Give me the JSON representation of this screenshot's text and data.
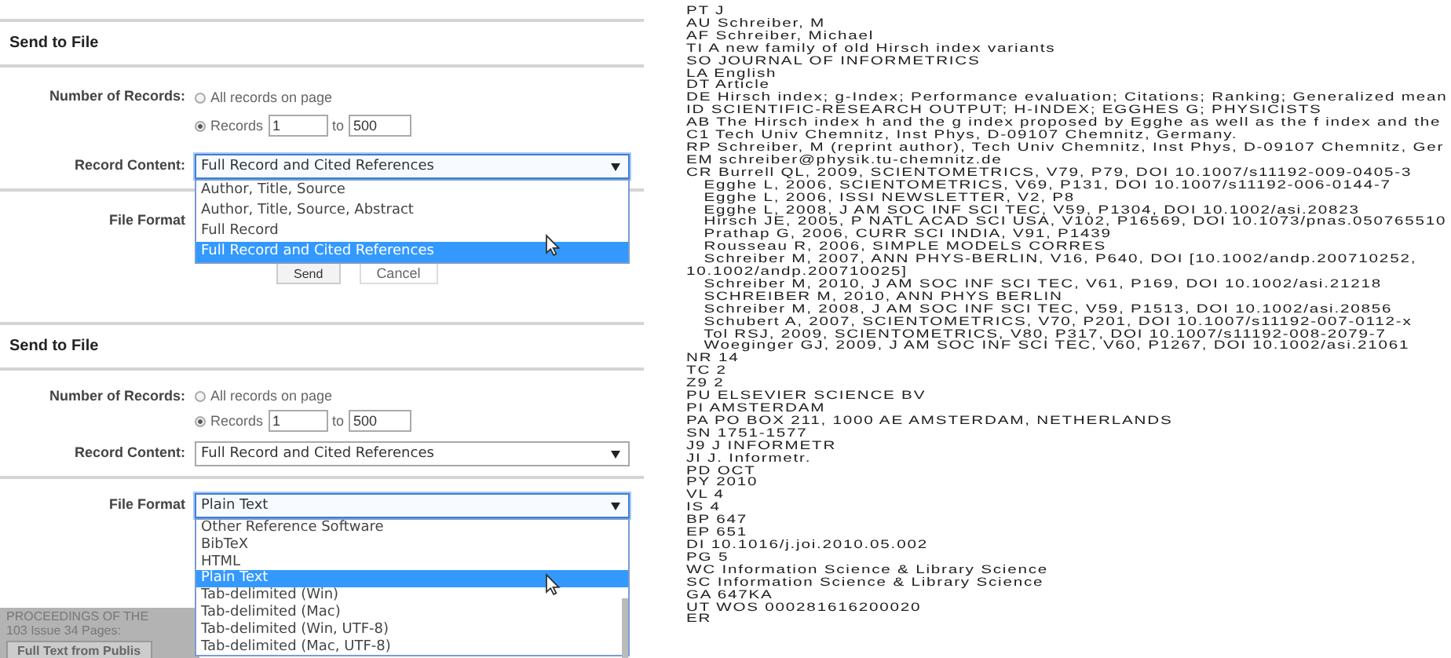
{
  "panels": [
    {
      "title": "Send to File",
      "sections": [
        {
          "fields": [
            {
              "kind": "radio_group",
              "label": "Number of Records:",
              "options": [
                {
                  "label": "All records on page",
                  "selected": false
                },
                {
                  "label": "Records",
                  "selected": true,
                  "from": "1",
                  "to_label": "to",
                  "to": "500"
                }
              ]
            },
            {
              "kind": "select",
              "label": "Record Content:",
              "value": "Full Record and Cited References",
              "expanded": true,
              "options": [
                {
                  "label": "Author, Title, Source",
                  "selected": false
                },
                {
                  "label": "Author, Title, Source, Abstract",
                  "selected": false
                },
                {
                  "label": "Full Record",
                  "selected": false
                },
                {
                  "label": "Full Record and Cited References",
                  "selected": true
                }
              ]
            }
          ]
        },
        {
          "fields": [
            {
              "kind": "select",
              "label": "File Format"
            }
          ],
          "buttons": [
            "Send",
            "Cancel"
          ]
        }
      ]
    },
    {
      "title": "Send to File",
      "sections": [
        {
          "fields": [
            {
              "kind": "radio_group",
              "label": "Number of Records:",
              "options": [
                {
                  "label": "All records on page",
                  "selected": false
                },
                {
                  "label": "Records",
                  "selected": true,
                  "from": "1",
                  "to_label": "to",
                  "to": "500"
                }
              ]
            },
            {
              "kind": "select",
              "label": "Record Content:",
              "value": "Full Record and Cited References",
              "expanded": false
            }
          ]
        },
        {
          "fields": [
            {
              "kind": "select",
              "label": "File Format",
              "value": "Plain Text",
              "expanded": true,
              "options": [
                {
                  "label": "Other Reference Software",
                  "selected": false
                },
                {
                  "label": "BibTeX",
                  "selected": false
                },
                {
                  "label": "HTML",
                  "selected": false
                },
                {
                  "label": "Plain Text",
                  "selected": true
                },
                {
                  "label": "Tab-delimited (Win)",
                  "selected": false
                },
                {
                  "label": "Tab-delimited (Mac)",
                  "selected": false
                },
                {
                  "label": "Tab-delimited (Win, UTF-8)",
                  "selected": false
                },
                {
                  "label": "Tab-delimited (Mac, UTF-8)",
                  "selected": false
                }
              ]
            }
          ]
        }
      ]
    }
  ],
  "background": {
    "lines": [
      "PROCEEDINGS OF THE",
      "103  Issue 34  Pages:"
    ],
    "button": "Full Text from Publis"
  },
  "record_lines": [
    "PT J",
    "AU Schreiber, M",
    "AF Schreiber, Michael",
    "TI A new family of old Hirsch index variants",
    "SO JOURNAL OF INFORMETRICS",
    "LA English",
    "DT Article",
    "DE Hirsch index; g-Index; Performance evaluation; Citations; Ranking; Generalized mean",
    "ID SCIENTIFIC-RESEARCH OUTPUT; H-INDEX; EGGHES G; PHYSICISTS",
    "AB The Hirsch index h and the g index proposed by Egghe as well as the f index and the",
    "C1 Tech Univ Chemnitz, Inst Phys, D-09107 Chemnitz, Germany.",
    "RP Schreiber, M (reprint author), Tech Univ Chemnitz, Inst Phys, D-09107 Chemnitz, Ger",
    "EM schreiber@physik.tu-chemnitz.de",
    "CR Burrell QL, 2009, SCIENTOMETRICS, V79, P79, DOI 10.1007/s11192-009-0405-3",
    "   Egghe L, 2006, SCIENTOMETRICS, V69, P131, DOI 10.1007/s11192-006-0144-7",
    "   Egghe L, 2006, ISSI NEWSLETTER, V2, P8",
    "   Egghe L, 2008, J AM SOC INF SCI TEC, V59, P1304, DOI 10.1002/asi.20823",
    "   Hirsch JE, 2005, P NATL ACAD SCI USA, V102, P16569, DOI 10.1073/pnas.050765510",
    "   Prathap G, 2006, CURR SCI INDIA, V91, P1439",
    "   Rousseau R, 2006, SIMPLE MODELS CORRES",
    "   Schreiber M, 2007, ANN PHYS-BERLIN, V16, P640, DOI [10.1002/andp.200710252,",
    "10.1002/andp.200710025]",
    "   Schreiber M, 2010, J AM SOC INF SCI TEC, V61, P169, DOI 10.1002/asi.21218",
    "   SCHREIBER M, 2010, ANN PHYS BERLIN",
    "   Schreiber M, 2008, J AM SOC INF SCI TEC, V59, P1513, DOI 10.1002/asi.20856",
    "   Schubert A, 2007, SCIENTOMETRICS, V70, P201, DOI 10.1007/s11192-007-0112-x",
    "   Tol RSJ, 2009, SCIENTOMETRICS, V80, P317, DOI 10.1007/s11192-008-2079-7",
    "   Woeginger GJ, 2009, J AM SOC INF SCI TEC, V60, P1267, DOI 10.1002/asi.21061",
    "NR 14",
    "TC 2",
    "Z9 2",
    "PU ELSEVIER SCIENCE BV",
    "PI AMSTERDAM",
    "PA PO BOX 211, 1000 AE AMSTERDAM, NETHERLANDS",
    "SN 1751-1577",
    "J9 J INFORMETR",
    "JI J. Informetr.",
    "PD OCT",
    "PY 2010",
    "VL 4",
    "IS 4",
    "BP 647",
    "EP 651",
    "DI 10.1016/j.joi.2010.05.002",
    "PG 5",
    "WC Information Science & Library Science",
    "SC Information Science & Library Science",
    "GA 647KA",
    "UT WOS 000281616200020",
    "ER"
  ]
}
